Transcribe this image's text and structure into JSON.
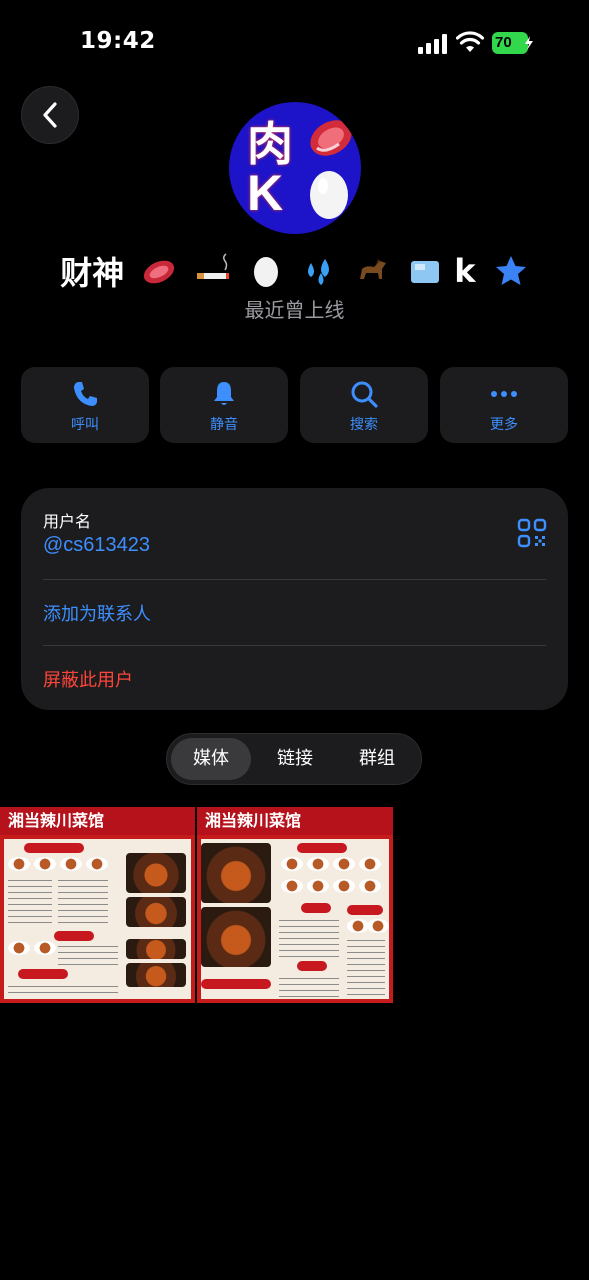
{
  "status_bar": {
    "time": "19:42",
    "battery": "70"
  },
  "profile": {
    "avatar_chars": [
      "肉",
      "K"
    ],
    "name_text": "财神",
    "name_suffix": "k",
    "name_emojis": [
      "meat-emoji",
      "cigarette-emoji",
      "egg-emoji",
      "sweat-droplets-emoji",
      "horse-emoji",
      "ice-emoji"
    ],
    "status": "最近曾上线"
  },
  "actions": [
    {
      "label": "呼叫",
      "icon": "phone-icon"
    },
    {
      "label": "静音",
      "icon": "bell-icon"
    },
    {
      "label": "搜索",
      "icon": "search-icon"
    },
    {
      "label": "更多",
      "icon": "more-icon"
    }
  ],
  "info": {
    "username_label": "用户名",
    "username": "@cs613423",
    "add_contact": "添加为联系人",
    "block_user": "屏蔽此用户"
  },
  "tabs": [
    {
      "label": "媒体",
      "active": true
    },
    {
      "label": "链接",
      "active": false
    },
    {
      "label": "群组",
      "active": false
    }
  ],
  "media": [
    {
      "title": "湘当辣川菜馆"
    },
    {
      "title": "湘当辣川菜馆"
    }
  ],
  "colors": {
    "accent": "#3d8fff",
    "danger": "#ff453a",
    "card": "#1c1c1e",
    "avatar_bg": "#1d14c9",
    "battery": "#32d74b"
  }
}
